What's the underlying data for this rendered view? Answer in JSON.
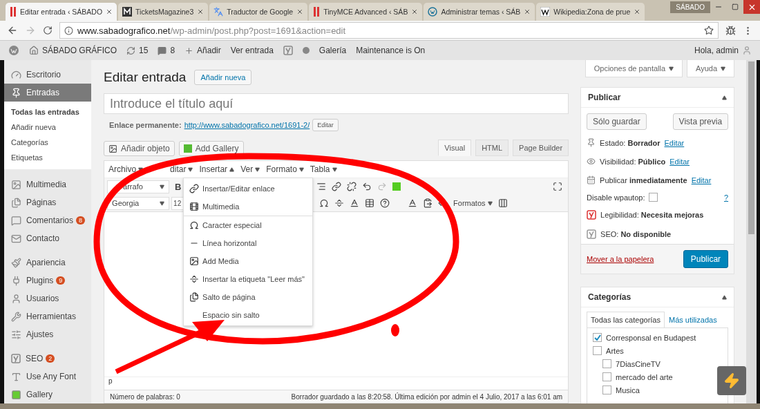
{
  "browser": {
    "tabs": [
      {
        "title": "Editar entrada ‹ SÁBADO",
        "kind": "bars",
        "selected": true
      },
      {
        "title": "TicketsMagazine3",
        "kind": "m",
        "selected": false
      },
      {
        "title": "Traductor de Google",
        "kind": "translate",
        "selected": false
      },
      {
        "title": "TinyMCE Advanced ‹ SÁB",
        "kind": "bars",
        "selected": false
      },
      {
        "title": "Administrar temas ‹ SÁB",
        "kind": "wp",
        "selected": false
      },
      {
        "title": "Wikipedia:Zona de prue",
        "kind": "w",
        "selected": false
      }
    ],
    "profile": "SÁBADO",
    "url": {
      "host": "www.sabadografico.net",
      "path": "/wp-admin/post.php?post=1691&action=edit"
    }
  },
  "admin_bar": {
    "site": "SÁBADO GRÁFICO",
    "updates": "15",
    "comments": "8",
    "add": "Añadir",
    "view": "Ver entrada",
    "gallery": "Galería",
    "maintenance": "Maintenance is On",
    "greeting": "Hola, admin"
  },
  "sidebar": {
    "items": [
      {
        "label": "Escritorio",
        "kind": "gauge",
        "selected": false
      },
      {
        "label": "Entradas",
        "kind": "pin",
        "selected": true,
        "children": [
          {
            "label": "Todas las entradas",
            "selected": true
          },
          {
            "label": "Añadir nueva",
            "selected": false
          },
          {
            "label": "Categorías",
            "selected": false
          },
          {
            "label": "Etiquetas",
            "selected": false
          }
        ]
      },
      {
        "label": "Multimedia",
        "kind": "media",
        "selected": false
      },
      {
        "label": "Páginas",
        "kind": "pages",
        "selected": false
      },
      {
        "label": "Comentarios",
        "kind": "comment",
        "selected": false,
        "badge": "8"
      },
      {
        "label": "Contacto",
        "kind": "mail",
        "selected": false
      },
      {
        "label": "Apariencia",
        "kind": "brush",
        "selected": false
      },
      {
        "label": "Plugins",
        "kind": "plug",
        "selected": false,
        "badge": "9"
      },
      {
        "label": "Usuarios",
        "kind": "user",
        "selected": false
      },
      {
        "label": "Herramientas",
        "kind": "wrench",
        "selected": false
      },
      {
        "label": "Ajustes",
        "kind": "sliders",
        "selected": false
      },
      {
        "label": "SEO",
        "kind": "seo",
        "selected": false,
        "badge": "2"
      },
      {
        "label": "Use Any Font",
        "kind": "font",
        "selected": false
      },
      {
        "label": "Gallery",
        "kind": "gallery",
        "selected": false
      }
    ]
  },
  "screen_options": [
    "Opciones de pantalla",
    "Ayuda"
  ],
  "editor": {
    "heading": "Editar entrada",
    "add_new": "Añadir nueva",
    "title_placeholder": "Introduce el título aquí",
    "permalink": {
      "label": "Enlace permanente:",
      "url": "http://www.sabadografico.net/1691-2/",
      "edit": "Editar"
    },
    "media_buttons": [
      {
        "label": "Añadir objeto",
        "kind": "media"
      },
      {
        "label": "Add Gallery",
        "kind": "gallery"
      }
    ],
    "tabs": [
      {
        "label": "Visual",
        "selected": true
      },
      {
        "label": "HTML",
        "selected": false
      },
      {
        "label": "Page Builder",
        "selected": false
      }
    ],
    "menubar": [
      {
        "label": "Archivo",
        "expanded": false
      },
      {
        "label": "ditar",
        "expanded": false
      },
      {
        "label": "Insertar",
        "expanded": true
      },
      {
        "label": "Ver",
        "expanded": false
      },
      {
        "label": "Formato",
        "expanded": false
      },
      {
        "label": "Tabla",
        "expanded": false
      }
    ],
    "format_select": "árrafo",
    "bold": "B",
    "font_select": "Georgia",
    "size_select": "12",
    "styles_menu": "Formatos",
    "insert_menu": [
      {
        "label": "Insertar/Editar enlace",
        "kind": "link"
      },
      {
        "label": "Multimedia",
        "kind": "film"
      },
      {
        "label": "Caracter especial",
        "kind": "omega"
      },
      {
        "label": "Línea horizontal",
        "kind": "line"
      },
      {
        "label": "Add Media",
        "kind": "media"
      },
      {
        "label": "Insertar la etiqueta \"Leer más\"",
        "kind": "more"
      },
      {
        "label": "Salto de página",
        "kind": "pages"
      },
      {
        "label": "Espacio sin salto",
        "kind": "plain"
      }
    ],
    "path": "p",
    "word_count": "Número de palabras: 0",
    "autosave": "Borrador guardado a las 8:20:58. Última edición por admin el 4 Julio, 2017 a las 6:01 am"
  },
  "publish": {
    "title": "Publicar",
    "save": "Sólo guardar",
    "preview": "Vista previa",
    "rows": [
      {
        "kind": "pin",
        "text": "Estado: **Borrador**",
        "link": "Editar"
      },
      {
        "kind": "eye",
        "text": "Visibilidad: **Público**",
        "link": "Editar"
      },
      {
        "kind": "calendar",
        "text": "Publicar **inmediatamente**",
        "link": "Editar"
      }
    ],
    "wpautop": {
      "label": "Disable wpautop:",
      "checked": false,
      "help": "?"
    },
    "seo_rows": [
      {
        "kind": "bad",
        "text": "Legibilidad: **Necesita mejoras**"
      },
      {
        "kind": "none",
        "text": "SEO: **No disponible**"
      }
    ],
    "trash": "Mover a la papelera",
    "publish": "Publicar"
  },
  "categories": {
    "title": "Categorías",
    "tabs": [
      {
        "label": "Todas las categorías",
        "selected": true
      },
      {
        "label": "Más utilizadas",
        "selected": false
      }
    ],
    "items": [
      {
        "label": "Corresponsal en Budapest",
        "checked": true
      },
      {
        "label": "Artes",
        "checked": false,
        "children": [
          {
            "label": "7DiasCineTV",
            "checked": false
          },
          {
            "label": "mercado del arte",
            "checked": false
          },
          {
            "label": "Musica",
            "checked": false
          }
        ]
      }
    ]
  }
}
